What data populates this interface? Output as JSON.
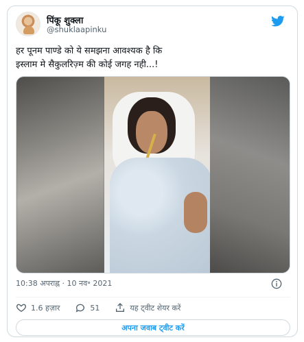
{
  "author": {
    "name": "पिंकू शुक्ला",
    "handle": "@shuklaapinku"
  },
  "tweet": {
    "text": "हर पूनम पाण्डे को ये समझना आवश्यक है कि\nइस्लाम मे सैकुलरिज़्म की कोई जगह नही...!"
  },
  "meta": {
    "timestamp": "10:38 अपराह्न · 10 नव॰ 2021"
  },
  "actions": {
    "likes": "1.6 हज़ार",
    "replies": "51",
    "share_label": "यह ट्वीट शेयर करें"
  },
  "reply_button": {
    "label": "अपना जवाब ट्वीट करें"
  },
  "colors": {
    "twitter_blue": "#1d9bf0",
    "secondary_text": "#536471",
    "border": "#cfd9de"
  }
}
